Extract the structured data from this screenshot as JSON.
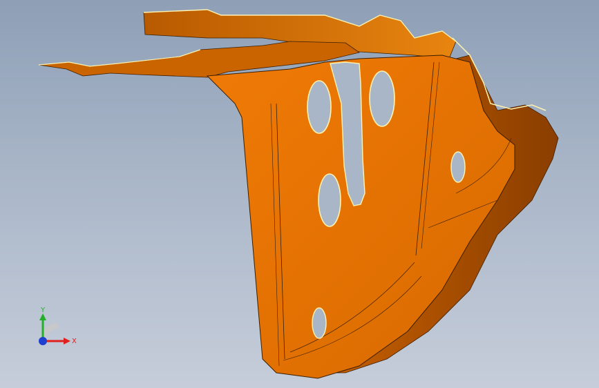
{
  "viewport": {
    "part_color": "#e07000",
    "part_dark": "#a84e00",
    "edge_highlight": "#fff3b0",
    "background_top": "#8e9fb6",
    "background_bottom": "#c6cdda"
  },
  "triad": {
    "x_label": "X",
    "y_label": "Y",
    "x_color": "#e0201c",
    "y_color": "#22b02a",
    "z_color": "#1e3fd0"
  }
}
